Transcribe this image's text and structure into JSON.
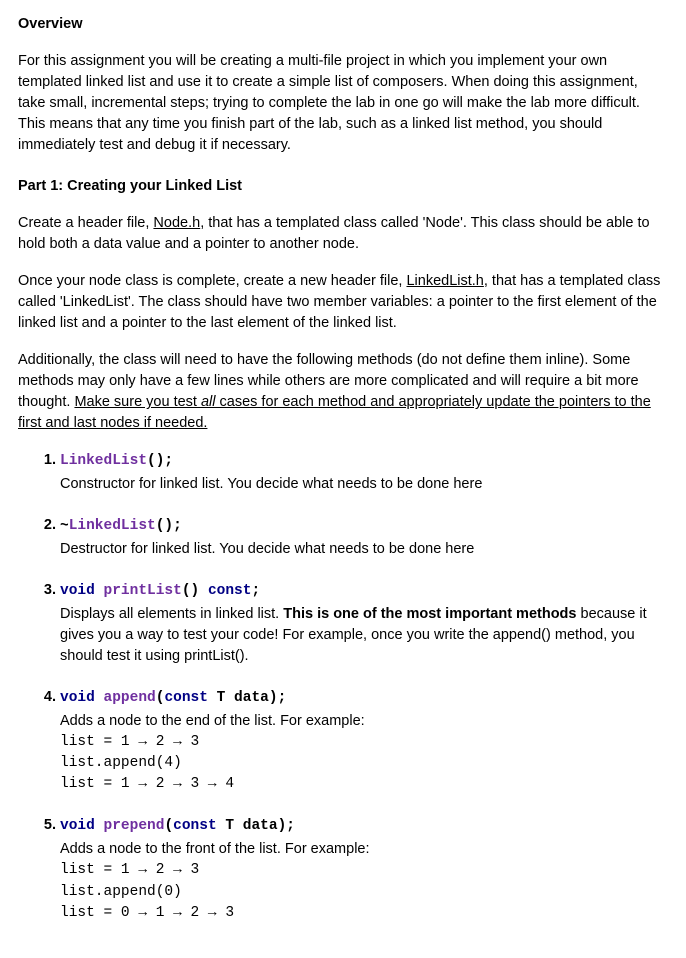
{
  "overview": {
    "title": "Overview",
    "text": "For this assignment you will be creating a multi-file project in which you implement your own templated linked list and use it to create a simple list of composers. When doing this assignment, take small, incremental steps; trying to complete the lab in one go will make the lab more difficult. This means that any time you finish part of the lab, such as a linked list method, you should immediately test and debug it if necessary."
  },
  "part1": {
    "title": "Part 1: Creating your Linked List",
    "p1_a": "Create a header file, ",
    "p1_file1": "Node.h",
    "p1_b": ", that has a templated class called 'Node'. This class should be able to hold both a data value and a pointer to another node.",
    "p2_a": "Once your node class is complete, create a new header file, ",
    "p2_file2": "LinkedList.h",
    "p2_b": ", that has a templated class called 'LinkedList'. The class should have two member variables: a pointer to the first element of the linked list and a pointer to the last element of the linked list.",
    "p3_a": "Additionally, the class will need to have the following methods (do not define them inline). Some methods may only have a few lines while others are more complicated and will require a bit more thought. ",
    "p3_u1": "Make sure you test ",
    "p3_u_ital": "all",
    "p3_u2": " cases for each method and appropriately update the pointers to the first and last nodes if needed."
  },
  "methods": {
    "m1": {
      "fn": "LinkedList",
      "post": "();",
      "desc": "Constructor for linked list. You decide what needs to be done here"
    },
    "m2": {
      "pre": "~",
      "fn": "LinkedList",
      "post": "();",
      "desc": "Destructor for linked list. You decide what needs to be done here"
    },
    "m3": {
      "kw1": "void",
      "sp1": " ",
      "fn": "printList",
      "mid": "() ",
      "kw2": "const",
      "post": ";",
      "desc_a": "Displays all elements in linked list. ",
      "desc_b": "This is one of the most important methods",
      "desc_c": " because it gives you a way to test your code! For example, once you write the append() method, you should test it using printList()."
    },
    "m4": {
      "kw1": "void",
      "sp1": " ",
      "fn": "append",
      "open": "(",
      "kw2": "const",
      "args": " T data",
      "close": ");",
      "desc": "Adds a node to the end of the list. For example:",
      "line1": "list = 1 → 2 → 3",
      "line2": "list.append(4)",
      "line3": "list = 1 → 2 → 3 → 4"
    },
    "m5": {
      "kw1": "void",
      "sp1": " ",
      "fn": "prepend",
      "open": "(",
      "kw2": "const",
      "args": " T data",
      "close": ");",
      "desc": "Adds a node to the front of the list. For example:",
      "line1": "list = 1 → 2 → 3",
      "line2": "list.append(0)",
      "line3": "list = 0 → 1 → 2 → 3"
    }
  }
}
